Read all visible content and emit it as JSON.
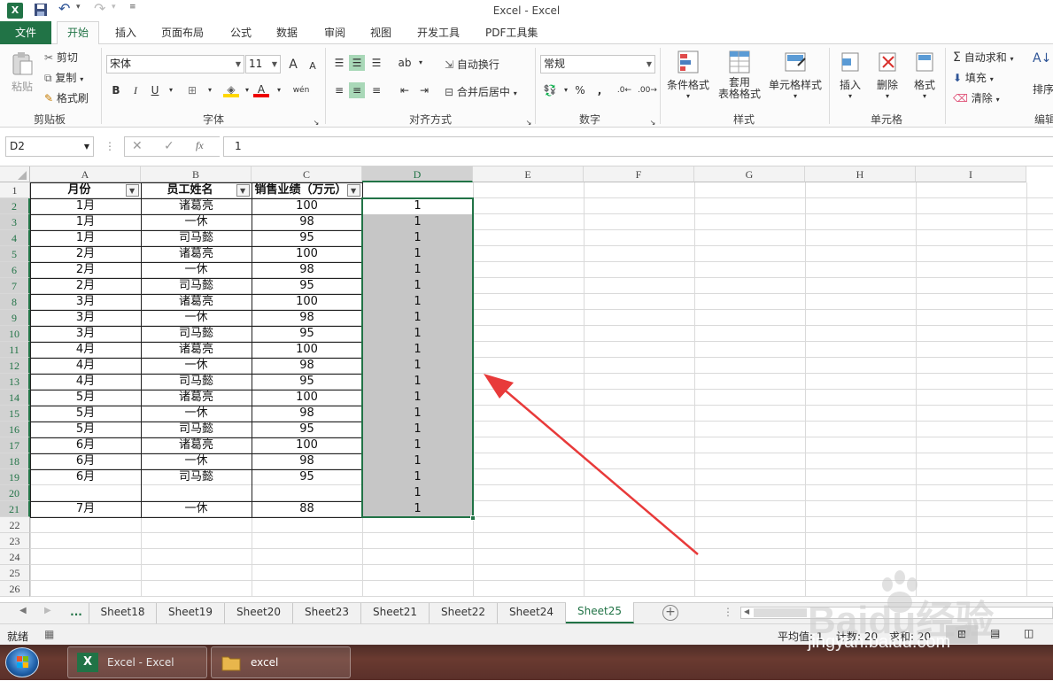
{
  "title_bar": {
    "title": "Excel - Excel",
    "app_icon": "excel-icon"
  },
  "tabs": [
    "文件",
    "开始",
    "插入",
    "页面布局",
    "公式",
    "数据",
    "审阅",
    "视图",
    "开发工具",
    "PDF工具集"
  ],
  "ribbon": {
    "clipboard": {
      "paste": "粘贴",
      "cut": "剪切",
      "copy": "复制",
      "format_painter": "格式刷",
      "label": "剪贴板"
    },
    "font": {
      "name": "宋体",
      "size": "11",
      "label": "字体",
      "bold": "B",
      "italic": "I",
      "underline": "U",
      "grow": "A",
      "shrink": "A",
      "phonetic": "wén"
    },
    "alignment": {
      "wrap": "自动换行",
      "merge": "合并后居中",
      "label": "对齐方式"
    },
    "number": {
      "format": "常规",
      "percent": "%",
      "comma": ",",
      "label": "数字"
    },
    "styles": {
      "conditional": "条件格式",
      "table_1": "套用",
      "table_2": "表格格式",
      "cell_styles": "单元格样式",
      "label": "样式"
    },
    "cells": {
      "insert": "插入",
      "delete": "删除",
      "format": "格式",
      "label": "单元格"
    },
    "editing": {
      "autosum": "自动求和",
      "fill": "填充",
      "clear": "清除",
      "sort": "排序",
      "label": "编辑"
    }
  },
  "formula_bar": {
    "name_box": "D2",
    "fx": "fx",
    "value": "1"
  },
  "columns": [
    "A",
    "B",
    "C",
    "D",
    "E",
    "F",
    "G",
    "H",
    "I"
  ],
  "rows": [
    "1",
    "2",
    "3",
    "4",
    "5",
    "6",
    "7",
    "8",
    "9",
    "10",
    "11",
    "12",
    "13",
    "14",
    "15",
    "16",
    "17",
    "18",
    "19",
    "20",
    "21",
    "22",
    "23",
    "24",
    "25",
    "26"
  ],
  "headers": [
    "月份",
    "员工姓名",
    "销售业绩（万元）"
  ],
  "table": [
    [
      "1月",
      "诸葛亮",
      "100",
      "1"
    ],
    [
      "1月",
      "一休",
      "98",
      "1"
    ],
    [
      "1月",
      "司马懿",
      "95",
      "1"
    ],
    [
      "2月",
      "诸葛亮",
      "100",
      "1"
    ],
    [
      "2月",
      "一休",
      "98",
      "1"
    ],
    [
      "2月",
      "司马懿",
      "95",
      "1"
    ],
    [
      "3月",
      "诸葛亮",
      "100",
      "1"
    ],
    [
      "3月",
      "一休",
      "98",
      "1"
    ],
    [
      "3月",
      "司马懿",
      "95",
      "1"
    ],
    [
      "4月",
      "诸葛亮",
      "100",
      "1"
    ],
    [
      "4月",
      "一休",
      "98",
      "1"
    ],
    [
      "4月",
      "司马懿",
      "95",
      "1"
    ],
    [
      "5月",
      "诸葛亮",
      "100",
      "1"
    ],
    [
      "5月",
      "一休",
      "98",
      "1"
    ],
    [
      "5月",
      "司马懿",
      "95",
      "1"
    ],
    [
      "6月",
      "诸葛亮",
      "100",
      "1"
    ],
    [
      "6月",
      "一休",
      "98",
      "1"
    ],
    [
      "6月",
      "司马懿",
      "95",
      "1"
    ],
    [
      "",
      "",
      "",
      "1"
    ],
    [
      "7月",
      "一休",
      "88",
      "1"
    ]
  ],
  "sheet_tabs": [
    "...",
    "Sheet18",
    "Sheet19",
    "Sheet20",
    "Sheet23",
    "Sheet21",
    "Sheet22",
    "Sheet24",
    "Sheet25"
  ],
  "active_sheet": "Sheet25",
  "status": {
    "ready": "就绪",
    "average": "平均值: 1",
    "count": "计数: 20",
    "sum": "求和: 20"
  },
  "taskbar": {
    "excel": "Excel - Excel",
    "folder": "excel"
  },
  "watermark": {
    "brand": "Baidu经验",
    "url": "jingyan.baidu.com"
  },
  "colors": {
    "excel_green": "#217346",
    "selection": "#c6c6c6",
    "arrow": "#e83a3a"
  }
}
